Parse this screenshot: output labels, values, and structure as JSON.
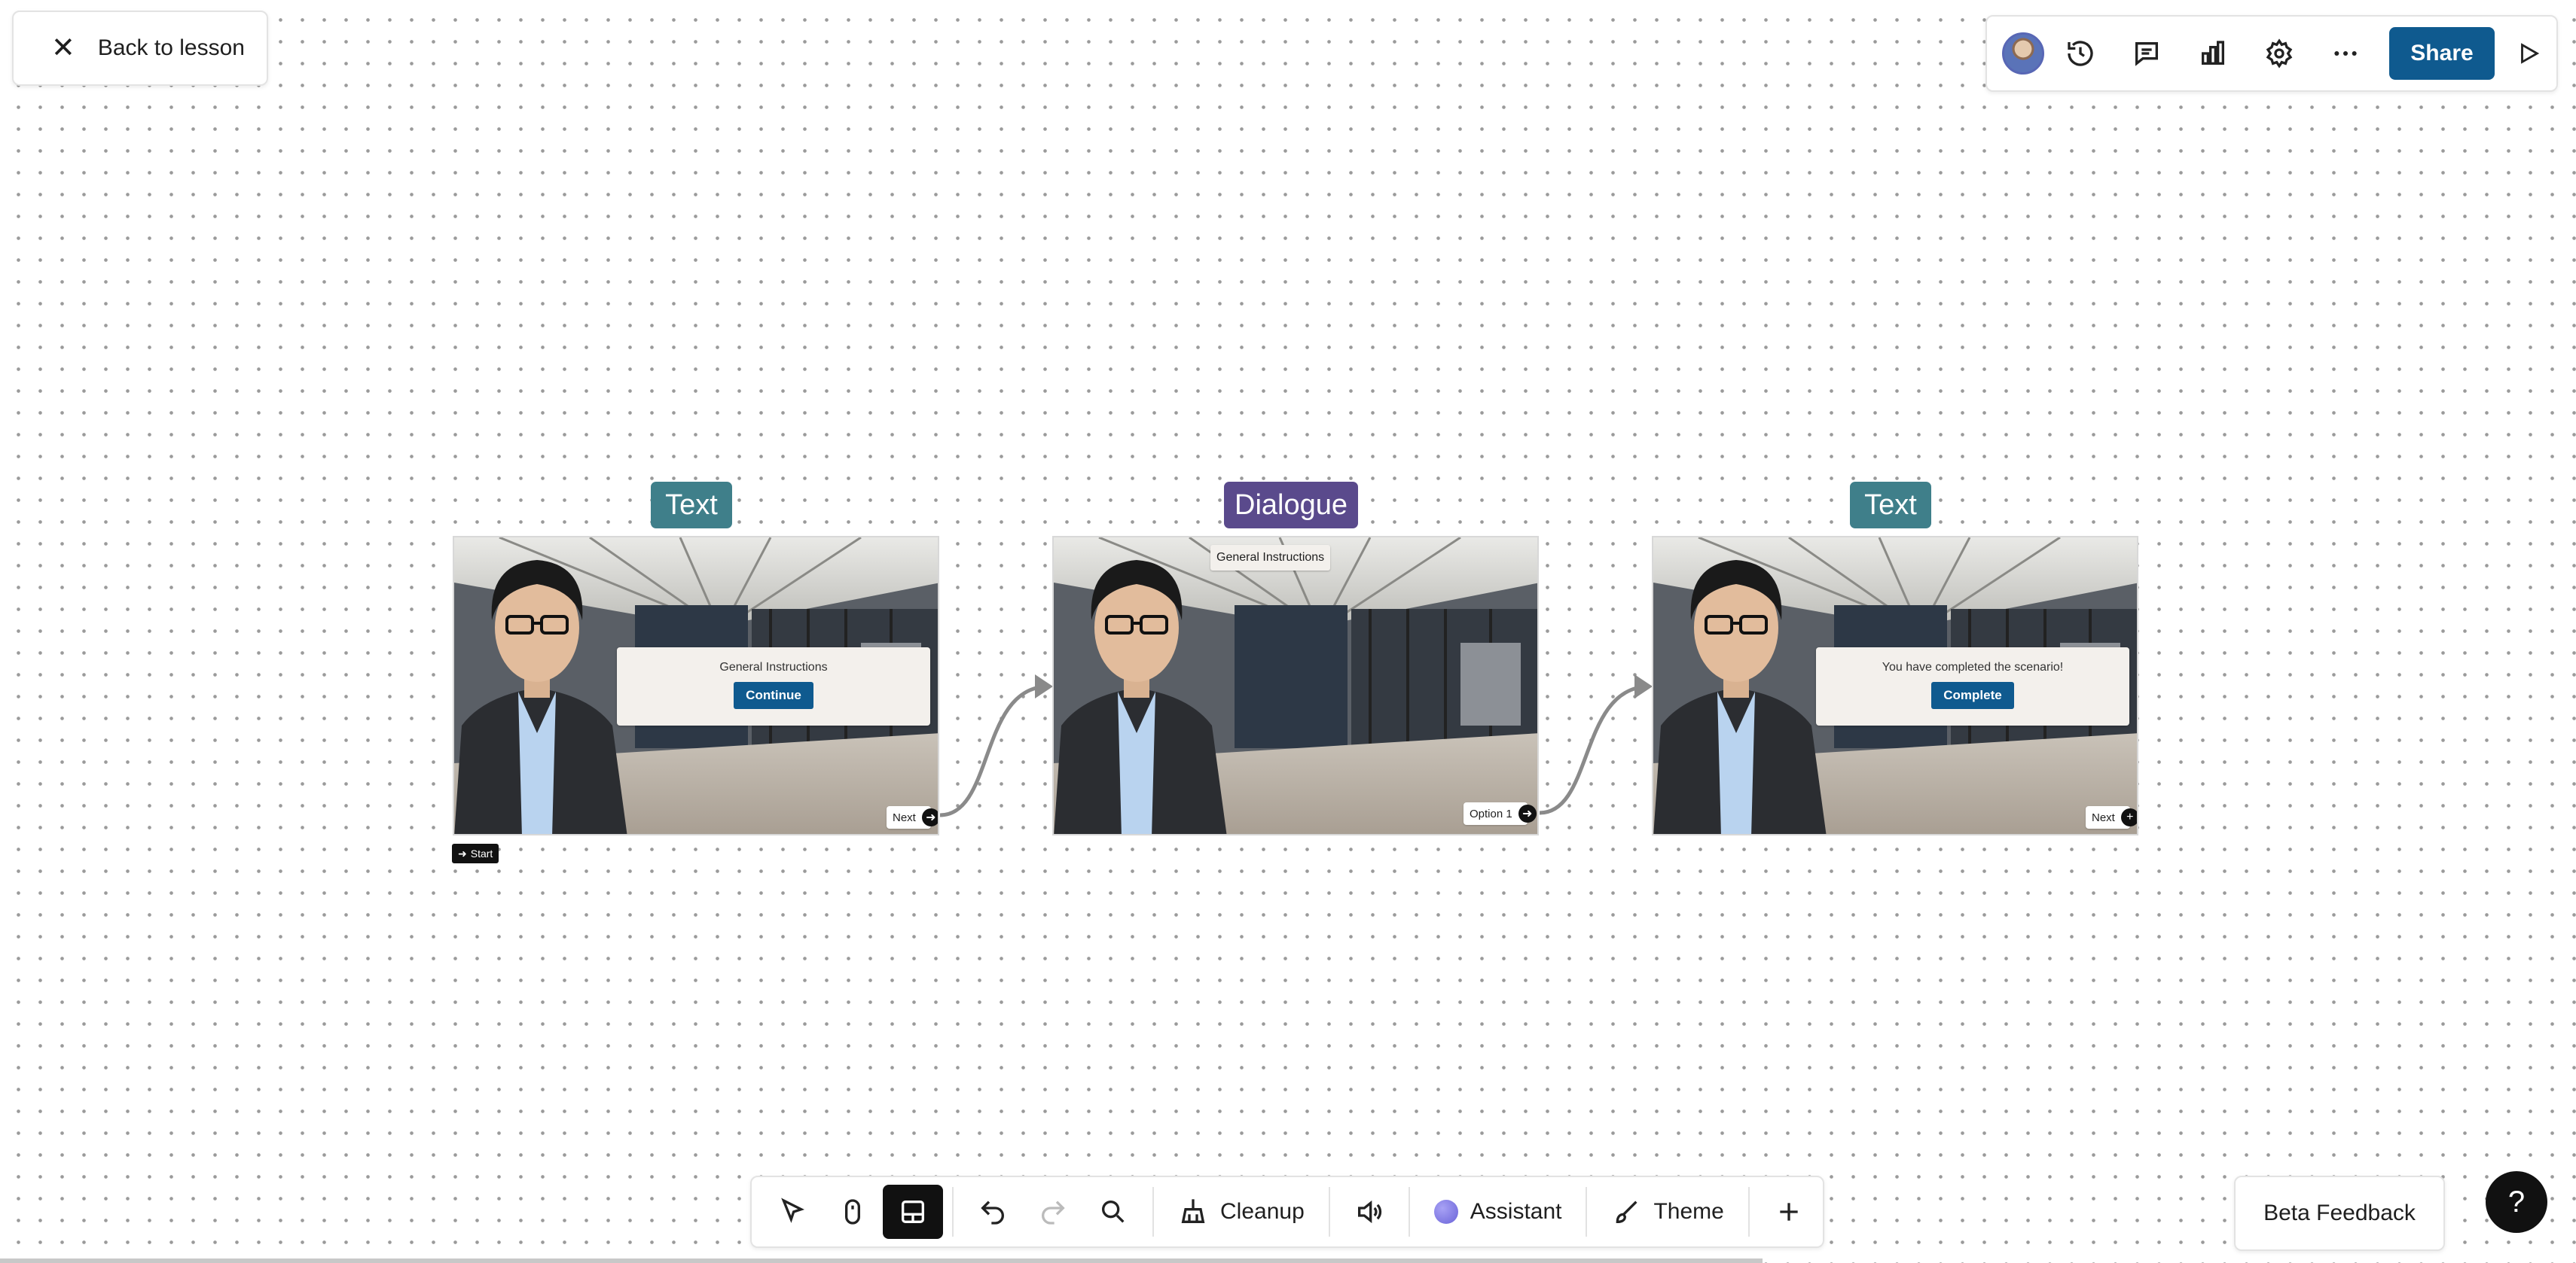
{
  "nav": {
    "back_label": "Back to lesson"
  },
  "topbar": {
    "share_label": "Share",
    "icons": [
      "avatar",
      "history-icon",
      "comment-icon",
      "analytics-icon",
      "settings-icon",
      "more-icon",
      "play-icon"
    ]
  },
  "nodes": [
    {
      "tag": "Text",
      "tag_type": "text",
      "dialog_text": "General Instructions",
      "button_label": "Continue",
      "exit_label": "Next"
    },
    {
      "tag": "Dialogue",
      "tag_type": "dialogue",
      "header_chip": "General Instructions",
      "exit_label": "Option 1"
    },
    {
      "tag": "Text",
      "tag_type": "text",
      "dialog_text": "You have completed the scenario!",
      "button_label": "Complete",
      "exit_label": "Next"
    }
  ],
  "start_label": "Start",
  "toolbar": {
    "cleanup_label": "Cleanup",
    "assistant_label": "Assistant",
    "theme_label": "Theme"
  },
  "beta_feedback_label": "Beta Feedback",
  "help_label": "?",
  "colors": {
    "primary": "#0f5a8f",
    "text_tag": "#3f7f8a",
    "dialogue_tag": "#5a4a8c",
    "assistant": "#8b84e6"
  }
}
